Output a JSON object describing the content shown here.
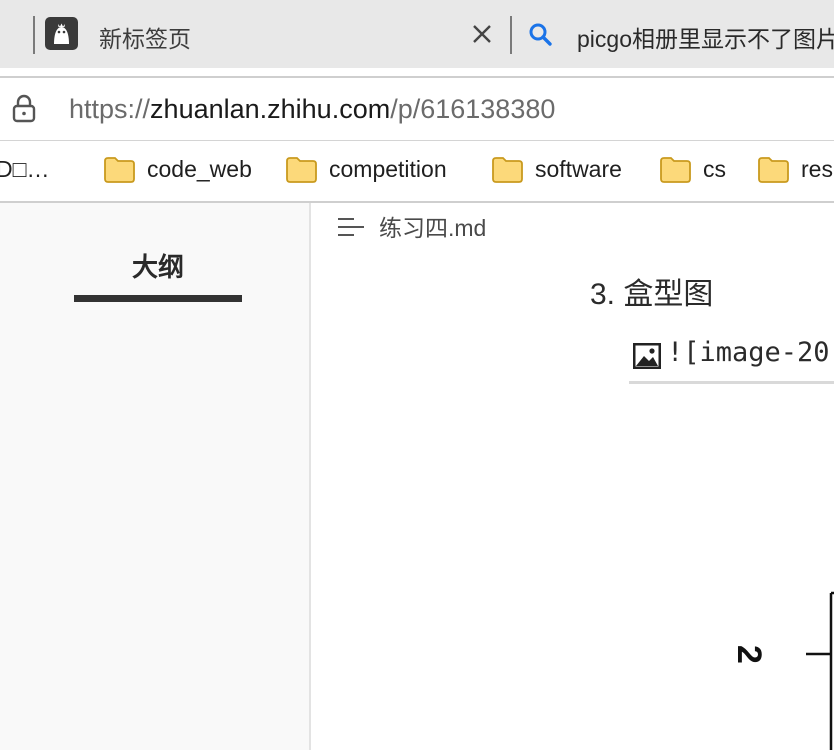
{
  "tabs": [
    {
      "title": "新标签页",
      "icon": "app-logo-icon",
      "closable": true
    },
    {
      "title": "picgo相册里显示不了图片",
      "icon": "search-icon"
    }
  ],
  "address_bar": {
    "icon": "lock-icon",
    "url_scheme": "https://",
    "url_domain": "zhuanlan.zhihu.com",
    "url_path": "/p/616138380"
  },
  "bookmarks": [
    {
      "label": "D□…",
      "icon": null
    },
    {
      "label": "code_web",
      "icon": "folder-icon"
    },
    {
      "label": "competition",
      "icon": "folder-icon"
    },
    {
      "label": "software",
      "icon": "folder-icon"
    },
    {
      "label": "cs",
      "icon": "folder-icon"
    },
    {
      "label": "rese",
      "icon": "folder-icon"
    }
  ],
  "sidebar": {
    "outline_title": "大纲"
  },
  "editor": {
    "doc_title": "练习四.md",
    "heading": "3. 盒型图",
    "image_markdown": "![image-20",
    "chart_tick_label": "2"
  },
  "colors": {
    "tab_bar_bg": "#e8e8e8",
    "folder_fill": "#fcd97a",
    "folder_stroke": "#c99a1e",
    "search_icon": "#1a73e8",
    "sidebar_bg": "#f9f9f9"
  }
}
